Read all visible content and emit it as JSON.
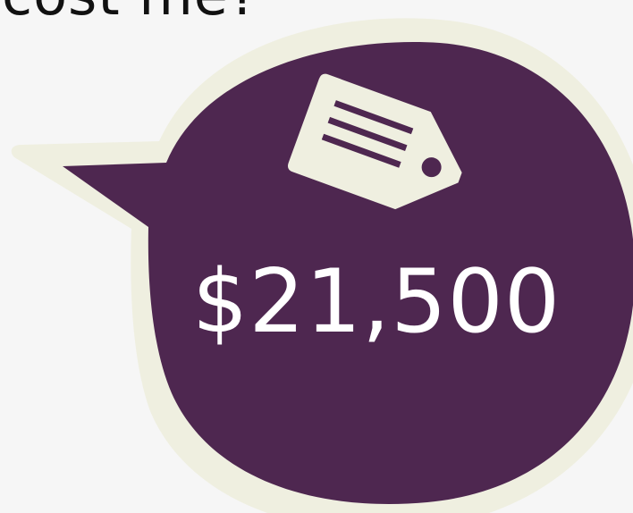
{
  "heading": {
    "text": "cost me?"
  },
  "bubble": {
    "price": "$21,500",
    "fill_color": "#4e2750",
    "outline_color": "#efefe0",
    "icon": "price-tag-icon"
  }
}
